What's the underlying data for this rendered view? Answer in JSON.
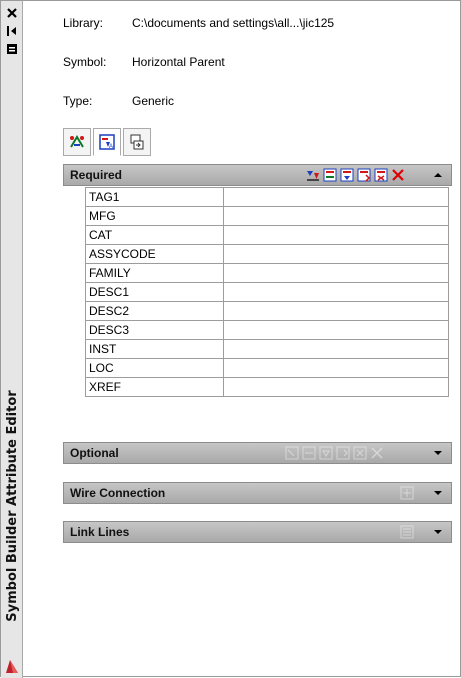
{
  "palette": {
    "vertical_title": "Symbol Builder Attribute Editor",
    "title_buttons": [
      "close-icon",
      "auto-hide-icon",
      "properties-icon"
    ]
  },
  "info": {
    "library_label": "Library:",
    "library_value": "C:\\documents and settings\\all...\\jic125",
    "symbol_label": "Symbol:",
    "symbol_value": "Horizontal Parent",
    "type_label": "Type:",
    "type_value": "Generic"
  },
  "tabs": [
    "attributes-tab-icon",
    "insert-attribute-tab-icon",
    "convert-tab-icon"
  ],
  "sections": {
    "required": {
      "title": "Required",
      "tools": [
        "insert-attribute-icon",
        "edit-attribute-icon",
        "add-attribute-icon",
        "copy-attribute-icon",
        "move-attribute-icon",
        "delete-icon"
      ],
      "rows": [
        {
          "tag": "TAG1",
          "value": ""
        },
        {
          "tag": "MFG",
          "value": ""
        },
        {
          "tag": "CAT",
          "value": ""
        },
        {
          "tag": "ASSYCODE",
          "value": ""
        },
        {
          "tag": "FAMILY",
          "value": ""
        },
        {
          "tag": "DESC1",
          "value": ""
        },
        {
          "tag": "DESC2",
          "value": ""
        },
        {
          "tag": "DESC3",
          "value": ""
        },
        {
          "tag": "INST",
          "value": ""
        },
        {
          "tag": "LOC",
          "value": ""
        },
        {
          "tag": "XREF",
          "value": ""
        }
      ]
    },
    "optional": {
      "title": "Optional"
    },
    "wire_connection": {
      "title": "Wire Connection"
    },
    "link_lines": {
      "title": "Link Lines"
    }
  },
  "colors": {
    "header_gradient_top": "#c6c6c6",
    "header_gradient_bottom": "#a9a9a9",
    "delete_red": "#e00000"
  }
}
